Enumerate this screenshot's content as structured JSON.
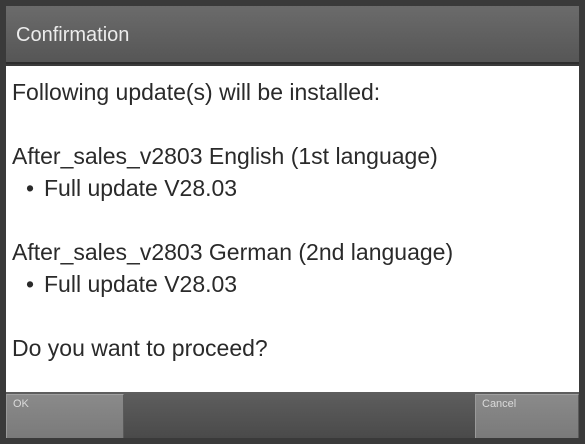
{
  "dialog": {
    "title": "Confirmation",
    "intro": "Following update(s) will be installed:",
    "updates": [
      {
        "name": "After_sales_v2803 English (1st language)",
        "detail": "Full update V28.03"
      },
      {
        "name": "After_sales_v2803 German (2nd language)",
        "detail": "Full update V28.03"
      }
    ],
    "question": "Do you want to proceed?"
  },
  "buttons": {
    "ok_label": "OK",
    "cancel_label": "Cancel"
  },
  "colors": {
    "title_bg": "#5f5f5f",
    "content_bg": "#ffffff",
    "button_bg": "#808080"
  }
}
